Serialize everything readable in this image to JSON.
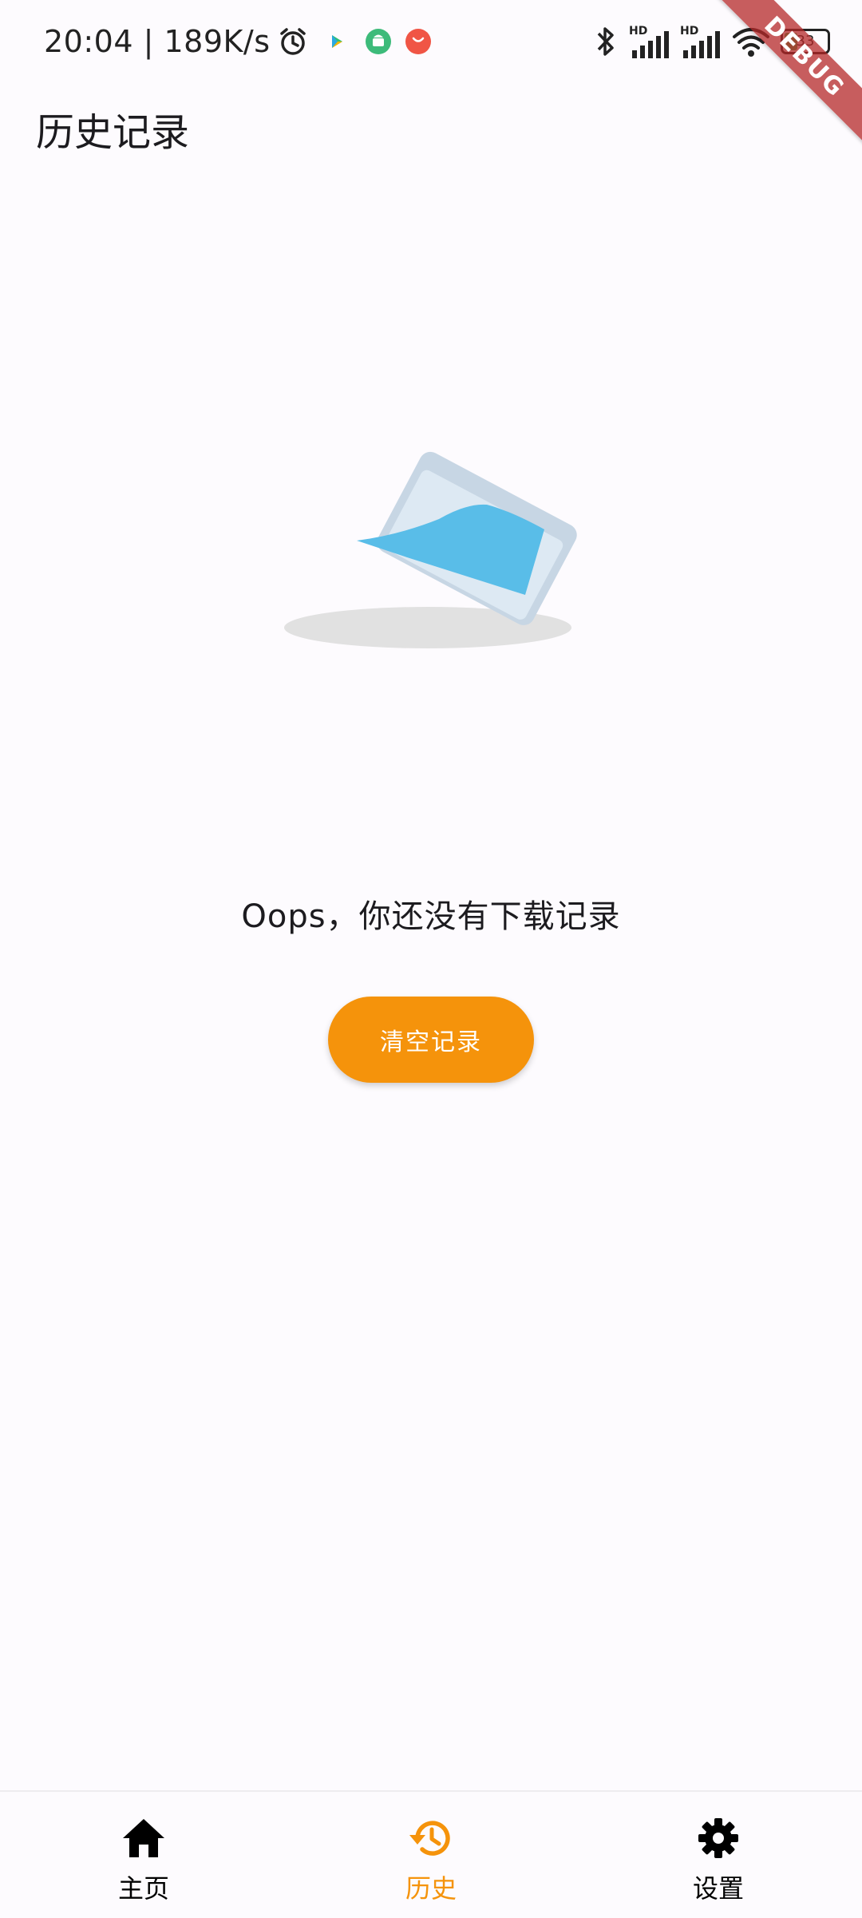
{
  "status_bar": {
    "time_speed": "20:04 | 189K/s",
    "battery_level": "33",
    "icons": [
      "alarm-icon",
      "play-store-icon",
      "android-icon",
      "notification-icon",
      "bluetooth-icon",
      "signal-hd-icon",
      "signal-hd-icon",
      "wifi-icon",
      "battery-icon"
    ]
  },
  "debug_banner": "DEBUG",
  "app_bar": {
    "title": "历史记录"
  },
  "empty_state": {
    "message": "Oops，你还没有下载记录",
    "button_label": "清空记录"
  },
  "bottom_nav": {
    "items": [
      {
        "label": "主页",
        "icon": "home-icon",
        "selected": false
      },
      {
        "label": "历史",
        "icon": "history-icon",
        "selected": true
      },
      {
        "label": "设置",
        "icon": "settings-icon",
        "selected": false
      }
    ],
    "selected_color": "#f5930b",
    "unselected_color": "#000000"
  },
  "colors": {
    "accent": "#f5930b",
    "background": "#fdfbfe",
    "illustration_blue": "#59bde8"
  }
}
